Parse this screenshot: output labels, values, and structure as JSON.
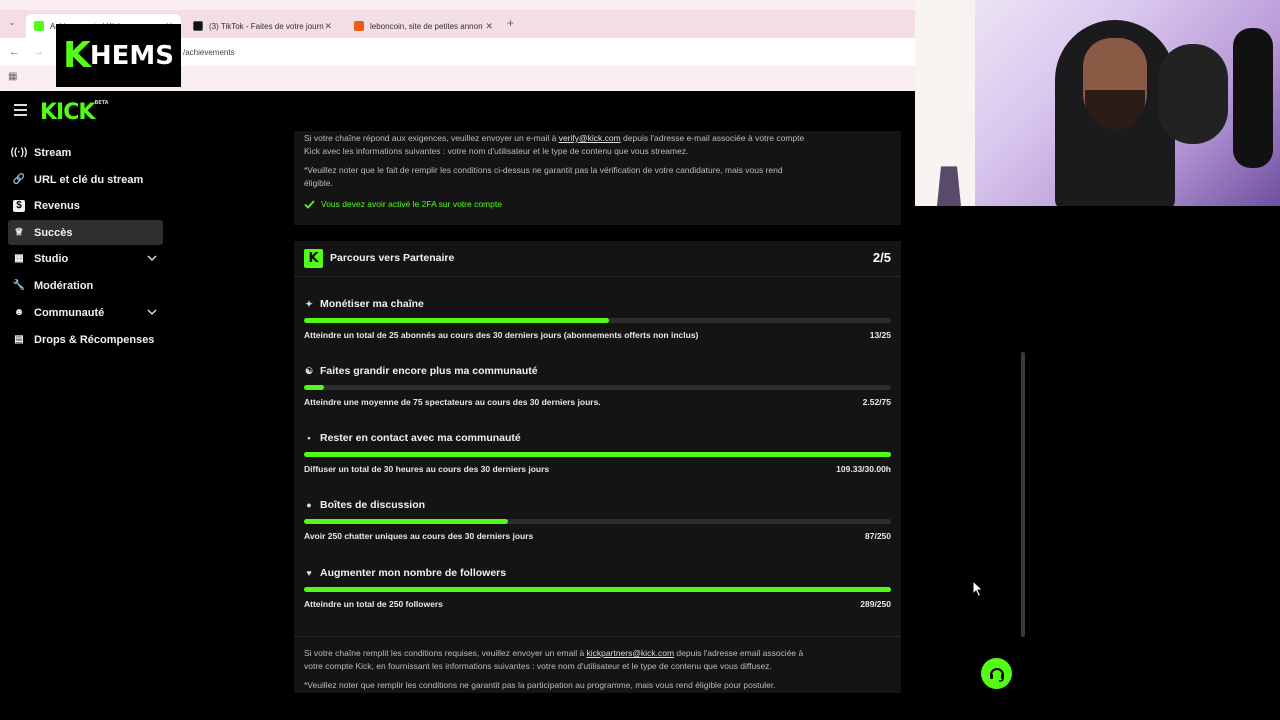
{
  "browser": {
    "tabs": [
      {
        "label": "Achievements | Kick",
        "icon": "kick-favicon"
      },
      {
        "label": "(3) TikTok - Faites de votre journ",
        "icon": "tiktok-favicon"
      },
      {
        "label": "leboncoin, site de petites annon",
        "icon": "leboncoin-favicon"
      }
    ],
    "new_tab": "+",
    "url": "/achievements"
  },
  "overlay": {
    "logo_k": "K",
    "logo_text": "HEMS"
  },
  "kick": {
    "logo": "KICK",
    "logo_badge": "BETA"
  },
  "sidebar": {
    "items": [
      {
        "label": "Stream",
        "icon": "broadcast-icon"
      },
      {
        "label": "URL et clé du stream",
        "icon": "link-icon"
      },
      {
        "label": "Revenus",
        "icon": "dollar-icon"
      },
      {
        "label": "Succès",
        "icon": "trophy-icon",
        "active": true
      },
      {
        "label": "Studio",
        "icon": "studio-icon",
        "expandable": true
      },
      {
        "label": "Modération",
        "icon": "wrench-icon"
      },
      {
        "label": "Communauté",
        "icon": "people-icon",
        "expandable": true
      },
      {
        "label": "Drops & Récompenses",
        "icon": "gift-icon"
      }
    ]
  },
  "verification": {
    "text1_pre": "Si votre chaîne répond aux exigences, veuillez envoyer un e-mail à ",
    "text1_email": "verify@kick.com",
    "text1_post": " depuis l'adresse e-mail associée à votre compte",
    "text2": "Kick avec les informations suivantes : votre nom d'utilisateur et le type de contenu que vous streamez.",
    "note1": "*Veuillez noter que le fait de remplir les conditions ci-dessus ne garantit pas la vérification de votre candidature, mais vous rend",
    "note2": "éligible.",
    "requirement": "Vous devez avoir activé le 2FA sur votre compte"
  },
  "partner": {
    "title": "Parcours vers Partenaire",
    "score": "2/5",
    "achievements": [
      {
        "title": "Monétiser ma chaîne",
        "icon": "sparkle-icon",
        "desc": "Atteindre un total de 25 abonnés au cours des 30 derniers jours (abonnements offerts non inclus)",
        "value": "13/25",
        "progress": 0.52
      },
      {
        "title": "Faites grandir encore plus ma communauté",
        "icon": "group-icon",
        "desc": "Atteindre une moyenne de 75 spectateurs au cours des 30 derniers jours.",
        "value": "2.52/75",
        "progress": 0.034
      },
      {
        "title": "Rester en contact avec ma communauté",
        "icon": "broadcast-small-icon",
        "desc": "Diffuser un total de 30 heures au cours des 30 derniers jours",
        "value": "109.33/30.00h",
        "progress": 1.0
      },
      {
        "title": "Boîtes de discussion",
        "icon": "chat-icon",
        "desc": "Avoir 250 chatter uniques au cours des 30 derniers jours",
        "value": "87/250",
        "progress": 0.348
      },
      {
        "title": "Augmenter mon nombre de followers",
        "icon": "heart-icon",
        "desc": "Atteindre un total de 250 followers",
        "value": "289/250",
        "progress": 1.0
      }
    ],
    "footer1_pre": "Si votre chaîne remplit les conditions requises, veuillez envoyer un email à ",
    "footer1_email": "kickpartners@kick.com",
    "footer1_post": " depuis l'adresse email associée à",
    "footer2": "votre compte Kick, en fournissant les informations suivantes : votre nom d'utilisateur et le type de contenu que vous diffusez.",
    "footer3": "*Veuillez noter que remplir les conditions ne garantit pas la participation au programme, mais vous rend éligible pour postuler."
  },
  "colors": {
    "accent": "#53fc18",
    "bg": "#000000",
    "card": "#141414"
  }
}
